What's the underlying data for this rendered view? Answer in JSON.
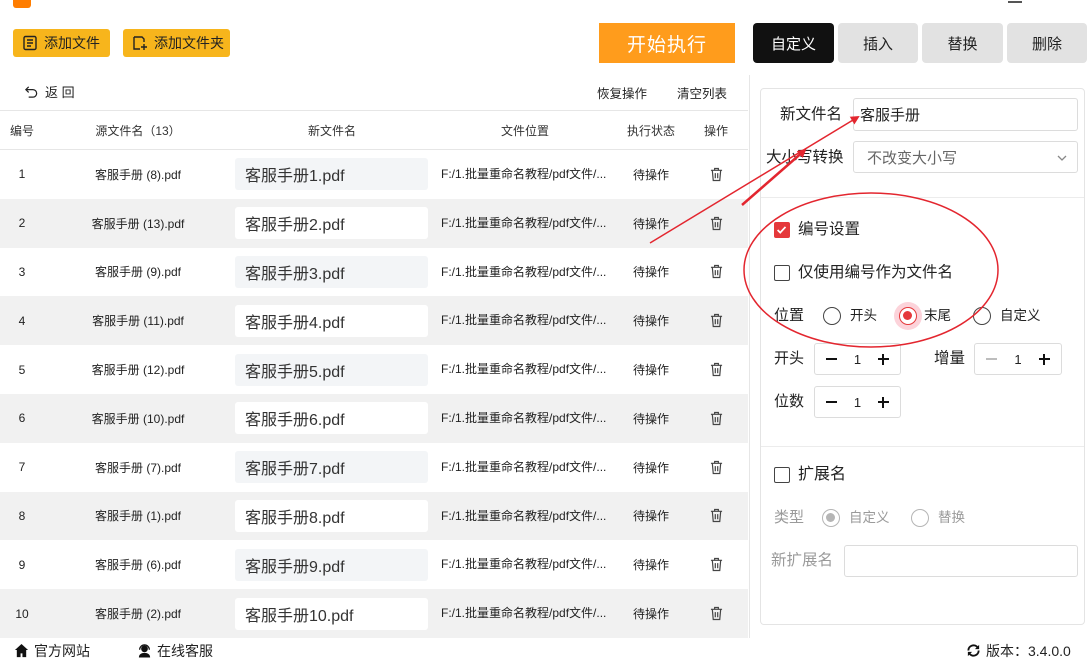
{
  "app": {
    "accent_color": "#f7b51c",
    "primary_color": "#ff9c1c",
    "highlight_color": "#e5383b"
  },
  "toolbar": {
    "add_file": {
      "label": "添加文件",
      "icon": "add-file-icon"
    },
    "add_folder": {
      "label": "添加文件夹",
      "icon": "add-folder-icon"
    },
    "start": {
      "label": "开始执行"
    }
  },
  "tabs": [
    {
      "label": "自定义",
      "active": true
    },
    {
      "label": "插入",
      "active": false
    },
    {
      "label": "替换",
      "active": false
    },
    {
      "label": "删除",
      "active": false
    }
  ],
  "list_actions": {
    "back": "返 回",
    "restore": "恢复操作",
    "clear": "清空列表"
  },
  "table": {
    "headers": {
      "no": "编号",
      "source": "源文件名（13）",
      "new_name": "新文件名",
      "location": "文件位置",
      "status": "执行状态",
      "action": "操作"
    },
    "rows": [
      {
        "no": "1",
        "source": "客服手册 (8).pdf",
        "new_name": "客服手册1.pdf",
        "location": "F:/1.批量重命名教程/pdf文件/...",
        "status": "待操作"
      },
      {
        "no": "2",
        "source": "客服手册 (13).pdf",
        "new_name": "客服手册2.pdf",
        "location": "F:/1.批量重命名教程/pdf文件/...",
        "status": "待操作"
      },
      {
        "no": "3",
        "source": "客服手册 (9).pdf",
        "new_name": "客服手册3.pdf",
        "location": "F:/1.批量重命名教程/pdf文件/...",
        "status": "待操作"
      },
      {
        "no": "4",
        "source": "客服手册 (11).pdf",
        "new_name": "客服手册4.pdf",
        "location": "F:/1.批量重命名教程/pdf文件/...",
        "status": "待操作"
      },
      {
        "no": "5",
        "source": "客服手册 (12).pdf",
        "new_name": "客服手册5.pdf",
        "location": "F:/1.批量重命名教程/pdf文件/...",
        "status": "待操作"
      },
      {
        "no": "6",
        "source": "客服手册 (10).pdf",
        "new_name": "客服手册6.pdf",
        "location": "F:/1.批量重命名教程/pdf文件/...",
        "status": "待操作"
      },
      {
        "no": "7",
        "source": "客服手册 (7).pdf",
        "new_name": "客服手册7.pdf",
        "location": "F:/1.批量重命名教程/pdf文件/...",
        "status": "待操作"
      },
      {
        "no": "8",
        "source": "客服手册 (1).pdf",
        "new_name": "客服手册8.pdf",
        "location": "F:/1.批量重命名教程/pdf文件/...",
        "status": "待操作"
      },
      {
        "no": "9",
        "source": "客服手册 (6).pdf",
        "new_name": "客服手册9.pdf",
        "location": "F:/1.批量重命名教程/pdf文件/...",
        "status": "待操作"
      },
      {
        "no": "10",
        "source": "客服手册 (2).pdf",
        "new_name": "客服手册10.pdf",
        "location": "F:/1.批量重命名教程/pdf文件/...",
        "status": "待操作"
      }
    ]
  },
  "panel": {
    "new_name": {
      "label": "新文件名",
      "value": "客服手册"
    },
    "case": {
      "label": "大小写转换",
      "value": "不改变大小写"
    },
    "numbering": {
      "enabled": {
        "label": "编号设置",
        "checked": true
      },
      "only_number": {
        "label": "仅使用编号作为文件名",
        "checked": false
      },
      "position": {
        "label": "位置",
        "options": [
          "开头",
          "末尾",
          "自定义"
        ],
        "selected": "末尾"
      },
      "start": {
        "label": "开头",
        "value": "1"
      },
      "increment": {
        "label": "增量",
        "value": "1"
      },
      "digits": {
        "label": "位数",
        "value": "1"
      }
    },
    "extension": {
      "enabled": {
        "label": "扩展名",
        "checked": false
      },
      "type": {
        "label": "类型",
        "options": [
          "自定义",
          "替换"
        ],
        "selected": "自定义"
      },
      "new_ext": {
        "label": "新扩展名",
        "value": ""
      }
    }
  },
  "footer": {
    "website": "官方网站",
    "support": "在线客服",
    "version": "版本：3.4.0.0"
  },
  "annotations": {
    "color": "#e3262f"
  }
}
